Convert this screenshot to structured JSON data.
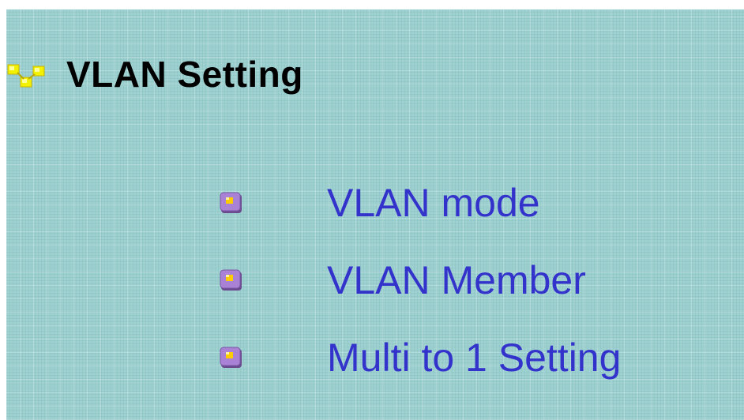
{
  "header": {
    "icon": "yellow-tree-node-icon",
    "title": "VLAN Setting"
  },
  "menu": {
    "bullet_icon": "purple-square-bullet-icon",
    "items": [
      {
        "label": "VLAN mode"
      },
      {
        "label": "VLAN Member"
      },
      {
        "label": "Multi to 1 Setting"
      }
    ]
  },
  "colors": {
    "panel_background": "#9fd1d1",
    "link": "#3333cc",
    "title": "#000000",
    "bullet": "#9966cc",
    "bullet_center": "#ffcc00",
    "header_icon": "#ffee00"
  }
}
